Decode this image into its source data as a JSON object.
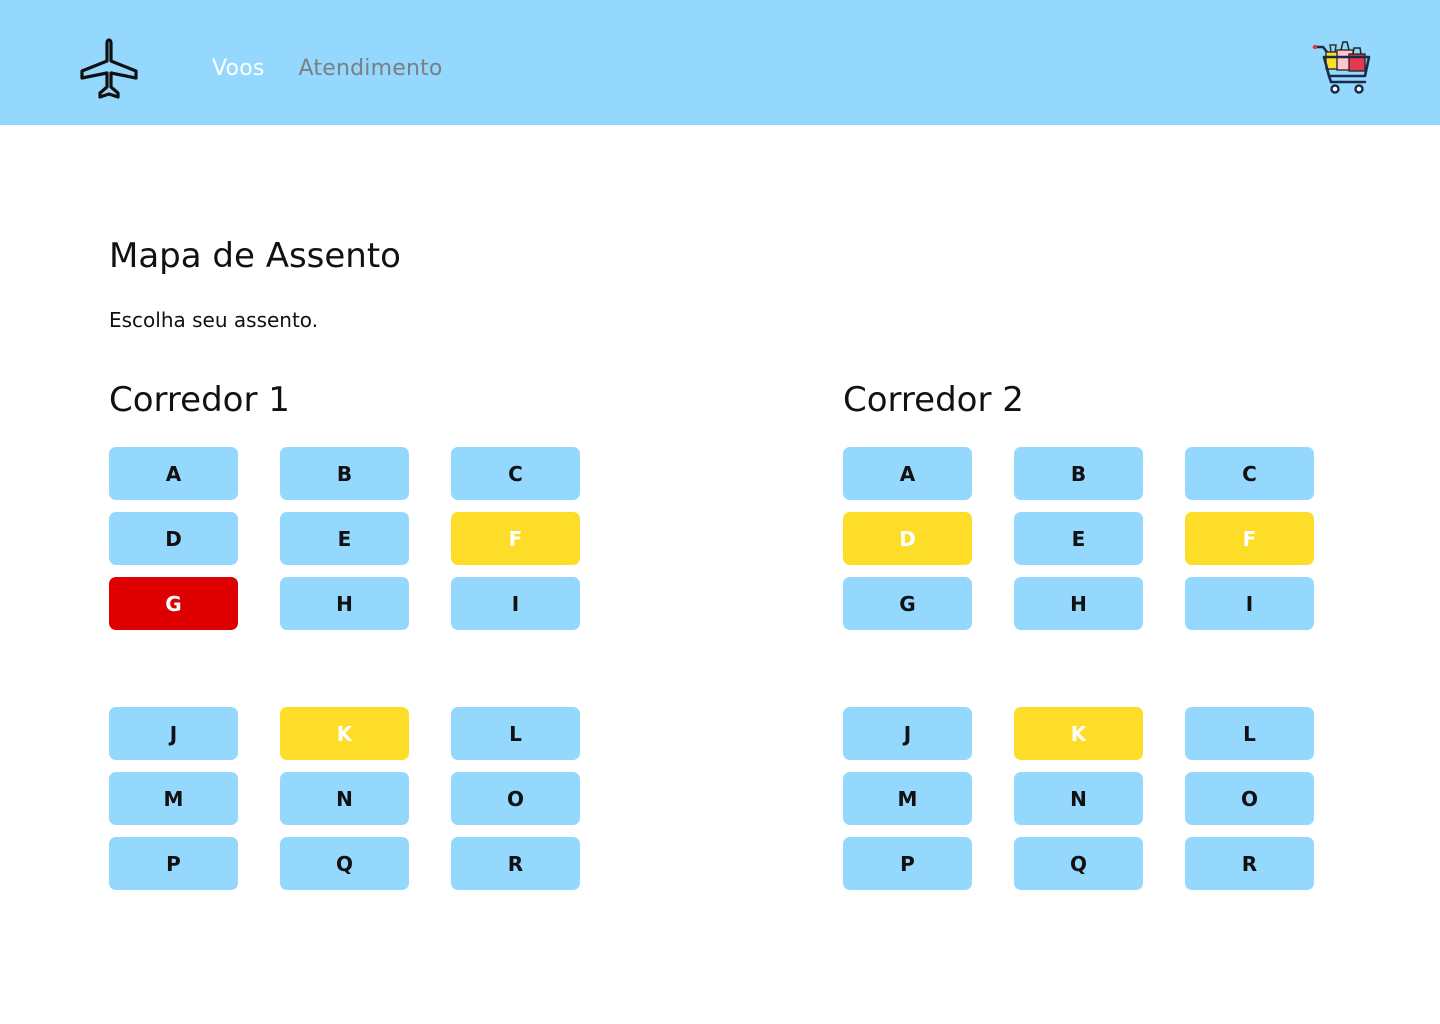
{
  "header": {
    "nav": [
      {
        "label": "Voos",
        "active": true
      },
      {
        "label": "Atendimento",
        "active": false
      }
    ],
    "logo_icon": "airplane-icon",
    "cart_icon": "shopping-cart-icon"
  },
  "main": {
    "title": "Mapa de Assento",
    "subtitle": "Escolha seu assento."
  },
  "colors": {
    "header_bg": "#94d8fe",
    "seat_available": "#94d8fe",
    "seat_selected": "#fddd27",
    "seat_occupied": "#de0000"
  },
  "corridors": [
    {
      "title": "Corredor 1",
      "seats": [
        {
          "label": "A",
          "status": "available"
        },
        {
          "label": "B",
          "status": "available"
        },
        {
          "label": "C",
          "status": "available"
        },
        {
          "label": "D",
          "status": "available"
        },
        {
          "label": "E",
          "status": "available"
        },
        {
          "label": "F",
          "status": "selected"
        },
        {
          "label": "G",
          "status": "occupied"
        },
        {
          "label": "H",
          "status": "available"
        },
        {
          "label": "I",
          "status": "available"
        },
        {
          "label": "J",
          "status": "available"
        },
        {
          "label": "K",
          "status": "selected"
        },
        {
          "label": "L",
          "status": "available"
        },
        {
          "label": "M",
          "status": "available"
        },
        {
          "label": "N",
          "status": "available"
        },
        {
          "label": "O",
          "status": "available"
        },
        {
          "label": "P",
          "status": "available"
        },
        {
          "label": "Q",
          "status": "available"
        },
        {
          "label": "R",
          "status": "available"
        }
      ]
    },
    {
      "title": "Corredor 2",
      "seats": [
        {
          "label": "A",
          "status": "available"
        },
        {
          "label": "B",
          "status": "available"
        },
        {
          "label": "C",
          "status": "available"
        },
        {
          "label": "D",
          "status": "selected"
        },
        {
          "label": "E",
          "status": "available"
        },
        {
          "label": "F",
          "status": "selected"
        },
        {
          "label": "G",
          "status": "available"
        },
        {
          "label": "H",
          "status": "available"
        },
        {
          "label": "I",
          "status": "available"
        },
        {
          "label": "J",
          "status": "available"
        },
        {
          "label": "K",
          "status": "selected"
        },
        {
          "label": "L",
          "status": "available"
        },
        {
          "label": "M",
          "status": "available"
        },
        {
          "label": "N",
          "status": "available"
        },
        {
          "label": "O",
          "status": "available"
        },
        {
          "label": "P",
          "status": "available"
        },
        {
          "label": "Q",
          "status": "available"
        },
        {
          "label": "R",
          "status": "available"
        }
      ]
    }
  ]
}
